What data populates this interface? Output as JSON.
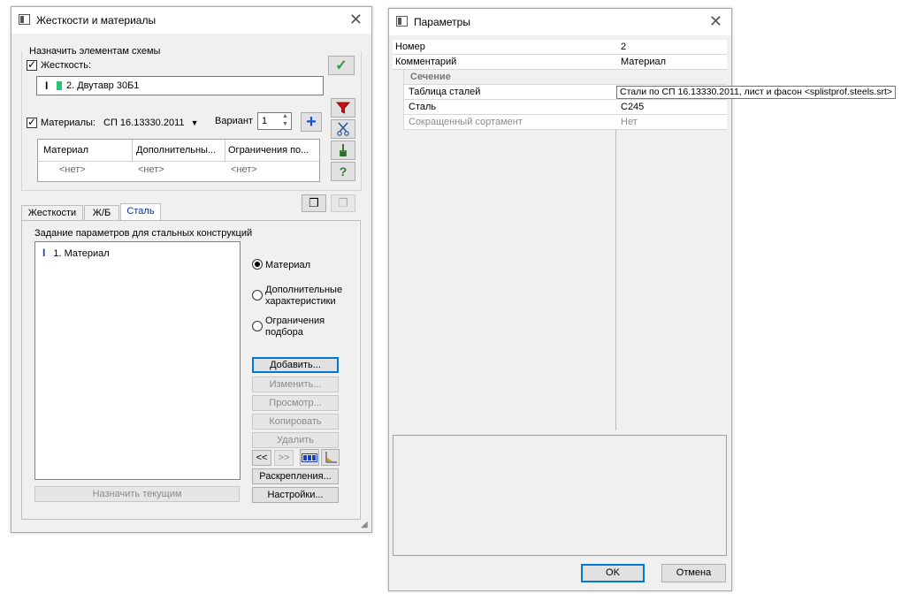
{
  "left_window": {
    "title": "Жесткости и материалы",
    "group_label": "Назначить элементам схемы",
    "stiffness_label": "Жесткость:",
    "stiffness_value": "2. Двутавр 30Б1",
    "materials_label": "Материалы:",
    "materials_standard": "СП 16.13330.2011",
    "variant_label": "Вариант",
    "variant_value": "1",
    "grid": {
      "headers": [
        "Материал",
        "Дополнительны...",
        "Ограничения по..."
      ],
      "row": [
        "<нет>",
        "<нет>",
        "<нет>"
      ]
    },
    "tabs": [
      "Жесткости",
      "Ж/Б",
      "Сталь"
    ],
    "active_tab": "Сталь",
    "steel_panel_title": "Задание параметров для стальных конструкций",
    "list_items": [
      "1. Материал"
    ],
    "radios": {
      "material": "Материал",
      "extra_line1": "Дополнительные",
      "extra_line2": "характеристики",
      "limits_line1": "Ограничения",
      "limits_line2": "подбора"
    },
    "buttons": {
      "add": "Добавить...",
      "edit": "Изменить...",
      "view": "Просмотр...",
      "copy": "Копировать",
      "delete": "Удалить",
      "prev": "<<",
      "next": ">>",
      "bracing": "Раскрепления...",
      "settings": "Настройки...",
      "assign_current": "Назначить текущим"
    },
    "icons": {
      "apply": "checkmark-icon",
      "filter": "filter-icon",
      "cut": "scissors-icon",
      "brush": "brush-icon",
      "help": "question-icon",
      "add": "plus-icon"
    }
  },
  "right_window": {
    "title": "Параметры",
    "rows": [
      {
        "key": "Номер",
        "value": "2"
      },
      {
        "key": "Комментарий",
        "value": "Материал"
      }
    ],
    "section_label": "Сечение",
    "section_rows": [
      {
        "key": "Таблица сталей",
        "value": "Стали по СП 16.13330.2011, лист и фасон <splistprof.steels.srt>"
      },
      {
        "key": "Сталь",
        "value": "С245"
      },
      {
        "key": "Сокращенный сортамент",
        "value": "Нет"
      }
    ],
    "ok": "OK",
    "cancel": "Отмена"
  },
  "colors": {
    "accent": "#0078d7",
    "check_green": "#2e9a3a",
    "filter_red": "#cc1111",
    "plus_blue": "#1a4fd6"
  }
}
